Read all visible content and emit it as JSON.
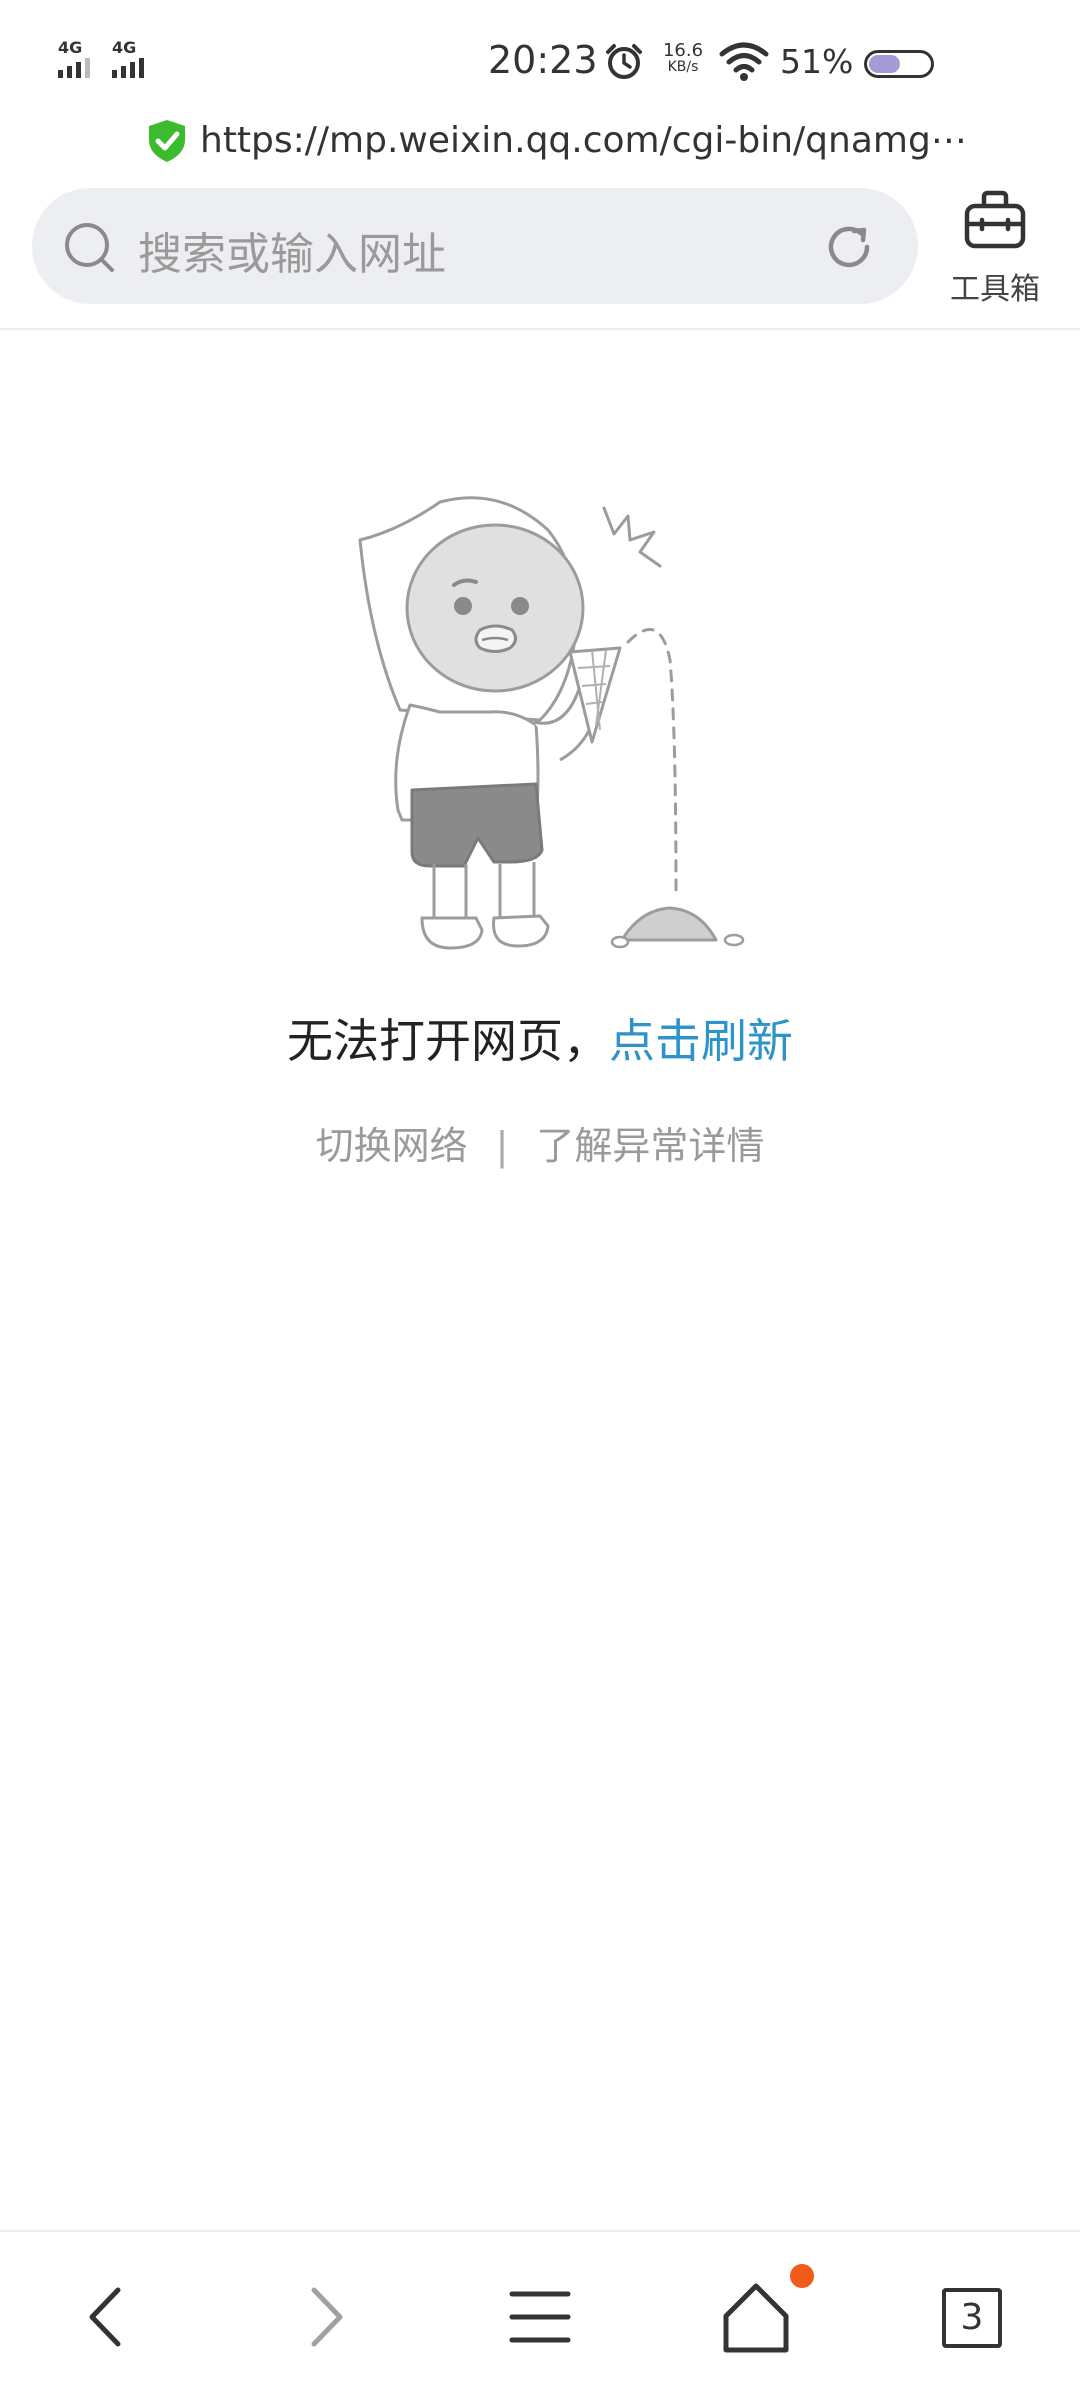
{
  "status_bar": {
    "sim1_label": "4G",
    "sim2_label": "4G",
    "time": "20:23",
    "net_speed_value": "16.6",
    "net_speed_unit": "KB/s",
    "battery_percent": "51%",
    "battery_level": 0.51,
    "icons": [
      "signal-icon",
      "alarm-icon",
      "wifi-icon",
      "battery-icon"
    ]
  },
  "url_bar": {
    "url": "https://mp.weixin.qq.com/cgi-bin/qnamg⋯",
    "secure_icon": "shield-check-icon",
    "secure_color": "#3dbb2f"
  },
  "search": {
    "placeholder": "搜索或输入网址",
    "toolbox_label": "工具箱"
  },
  "error": {
    "message": "无法打开网页，",
    "refresh_link": "点击刷新",
    "switch_network": "切换网络",
    "separator": "|",
    "details": "了解异常详情",
    "accent_color": "#2d93c9"
  },
  "bottom_nav": {
    "tab_count": "3",
    "badge_color": "#f25a1a",
    "items": [
      "back-icon",
      "forward-icon",
      "menu-icon",
      "home-icon",
      "tabs-icon"
    ]
  }
}
